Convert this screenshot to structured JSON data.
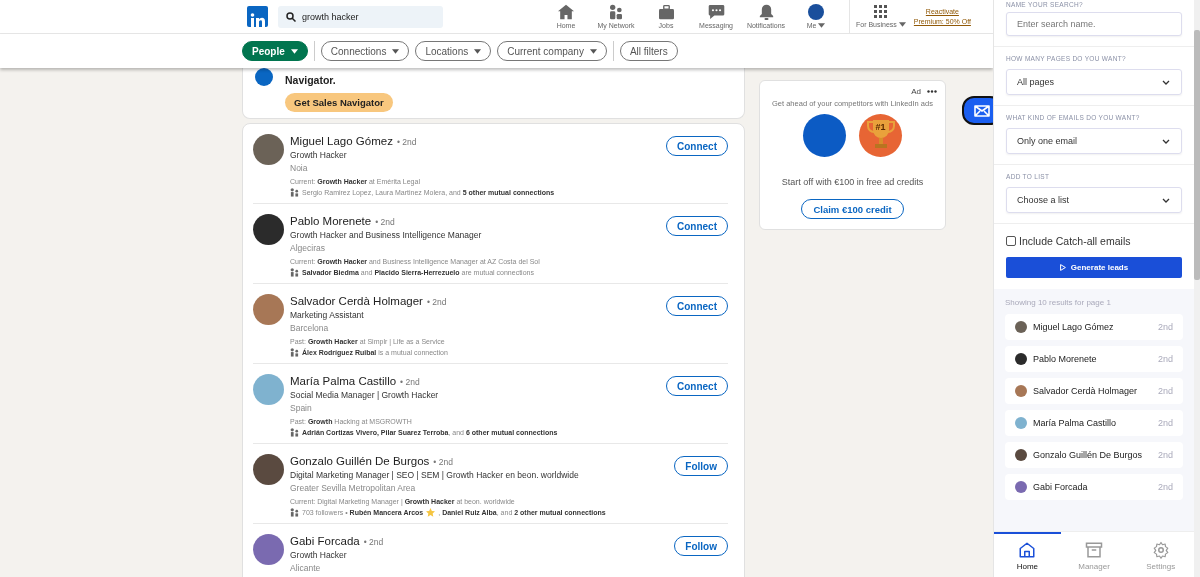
{
  "header": {
    "search": {
      "value": "growth hacker"
    },
    "nav": [
      {
        "label": "Home"
      },
      {
        "label": "My Network"
      },
      {
        "label": "Jobs"
      },
      {
        "label": "Messaging"
      },
      {
        "label": "Notifications"
      },
      {
        "label": "Me"
      }
    ],
    "business": {
      "label": "For Business"
    },
    "premium": [
      "Reactivate",
      "Premium: 50% Off"
    ]
  },
  "filters": [
    {
      "label": "People",
      "selected": true,
      "kind": "dropdown"
    },
    {
      "label": "Connections",
      "selected": false,
      "kind": "dropdown"
    },
    {
      "label": "Locations",
      "selected": false,
      "kind": "dropdown"
    },
    {
      "label": "Current company",
      "selected": false,
      "kind": "dropdown"
    },
    {
      "label": "All filters",
      "selected": false,
      "kind": "button"
    }
  ],
  "banner": {
    "text": "Navigator.",
    "button": "Get Sales Navigator"
  },
  "results": [
    {
      "name": "Miguel Lago Gómez",
      "degree": "• 2nd",
      "headline": "Growth Hacker",
      "location": "Noia",
      "insight": "Current: **Growth Hacker** at Emérita Legal",
      "mutual": [
        "Sergio Ramirez Lopez, Laura Martinez Molera, and **5 other mutual connections**"
      ],
      "action": "Connect"
    },
    {
      "name": "Pablo Morenete",
      "degree": "• 2nd",
      "headline": "Growth Hacker and Business Intelligence Manager",
      "location": "Algeciras",
      "insight": "Current: **Growth Hacker** and Business Intelligence Manager at AZ Costa del Sol",
      "mutual": [
        "**Salvador Biedma** and **Placido Sierra-Herrezuelo** are mutual connections"
      ],
      "action": "Connect"
    },
    {
      "name": "Salvador Cerdà Holmager",
      "degree": "• 2nd",
      "headline": "Marketing Assistant",
      "location": "Barcelona",
      "insight": "Past: **Growth Hacker** at Simplr | Life as a Service",
      "mutual": [
        "**Álex Rodríguez Ruibal** is a mutual connection"
      ],
      "action": "Connect"
    },
    {
      "name": "María Palma Castillo",
      "degree": "• 2nd",
      "headline": "Social Media Manager | Growth Hacker",
      "location": "Spain",
      "insight": "Past: **Growth** Hacking at MSGROWTH",
      "mutual": [
        "**Adrián Cortizas Vivero, Pilar Suarez Terroba**, and **6 other mutual connections**"
      ],
      "action": "Connect"
    },
    {
      "name": "Gonzalo Guillén De Burgos",
      "degree": "• 2nd",
      "headline": "Digital Marketing Manager | SEO | SEM | Growth Hacker en beon. worldwide",
      "location": "Greater Sevilla Metropolitan Area",
      "insight": "Current: Digital Marketing Manager | **Growth Hacker** at beon. worldwide",
      "mutual": [
        "703 followers • **Rubén Mancera Arcos**",
        ", **Daniel Ruiz Alba**, and **2 other mutual connections**"
      ],
      "action": "Follow"
    },
    {
      "name": "Gabi Forcada",
      "degree": "• 2nd",
      "headline": "Growth Hacker",
      "location": "Alicante",
      "action": "Follow"
    }
  ],
  "ad": {
    "label": "Ad",
    "title": "Get ahead of your competitors with LinkedIn ads",
    "badge": "#1",
    "text": "Start off with €100 in free ad credits",
    "button": "Claim €100 credit"
  },
  "panel": {
    "sections": [
      {
        "kind": "input",
        "label": "NAME YOUR SEARCH?",
        "placeholder": "Enter search name."
      },
      {
        "kind": "select",
        "label": "HOW MANY PAGES DO YOU WANT?",
        "value": "All pages"
      },
      {
        "kind": "select",
        "label": "WHAT KIND OF EMAILS DO YOU WANT?",
        "value": "Only one email"
      },
      {
        "kind": "select",
        "label": "ADD TO LIST",
        "value": "Choose a list"
      }
    ],
    "catch_all": {
      "label": "Include Catch-all emails",
      "checked": false
    },
    "generate": "Generate leads",
    "results_label": "Showing 10 results for page 1",
    "leads": [
      {
        "name": "Miguel Lago Gómez",
        "degree": "2nd"
      },
      {
        "name": "Pablo Morenete",
        "degree": "2nd"
      },
      {
        "name": "Salvador Cerdà Holmager",
        "degree": "2nd"
      },
      {
        "name": "María Palma Castillo",
        "degree": "2nd"
      },
      {
        "name": "Gonzalo Guillén De Burgos",
        "degree": "2nd"
      },
      {
        "name": "Gabi Forcada",
        "degree": "2nd"
      }
    ],
    "tabs": [
      {
        "label": "Home",
        "selected": true
      },
      {
        "label": "Manager",
        "selected": false
      },
      {
        "label": "Settings",
        "selected": false
      }
    ]
  }
}
